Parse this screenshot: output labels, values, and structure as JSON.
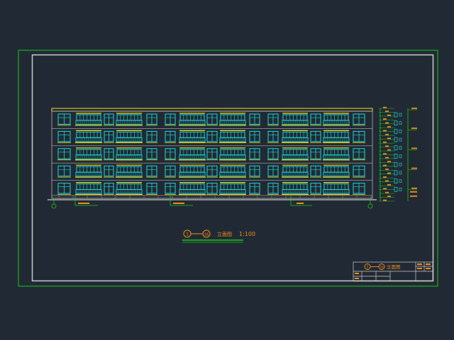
{
  "drawing": {
    "title_number_start": "1",
    "title_number_end": "16",
    "title_text": "立面图",
    "scale_text": "1:100",
    "axis_start_label": "1",
    "axis_end_label": "16"
  },
  "title_block": {
    "number_start": "1",
    "number_end": "16",
    "sheet_name": "立面图"
  },
  "colors": {
    "background": "#212a34",
    "outer_border": "#19c419",
    "inner_border": "#c9c9c9",
    "window_frame": "#19d8d8",
    "balcony": "#f0e020",
    "text_orange": "#f08c1e",
    "annotation_green": "#19c419",
    "floor_line": "#b0b0b0"
  },
  "building": {
    "floors": 5,
    "elevation_tags": 5
  }
}
